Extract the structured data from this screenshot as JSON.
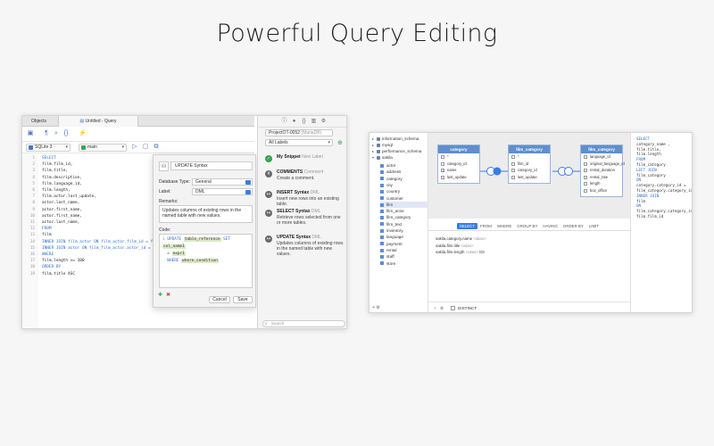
{
  "headline": "Powerful Query Editing",
  "left_window": {
    "tabs": [
      {
        "label": "Objects"
      },
      {
        "label": "Untitled - Query"
      }
    ],
    "connection": "SQLite 3",
    "schema": "main",
    "code_lines": [
      {
        "n": "1",
        "text": "SELECT"
      },
      {
        "n": "2",
        "text": "film.film_id,"
      },
      {
        "n": "3",
        "text": "film.title,"
      },
      {
        "n": "4",
        "text": "film.description,"
      },
      {
        "n": "5",
        "text": "film.language_id,"
      },
      {
        "n": "6",
        "text": "film.length,"
      },
      {
        "n": "7",
        "text": "film.actor.last_update,"
      },
      {
        "n": "8",
        "text": "actor.last_name,"
      },
      {
        "n": "9",
        "text": "actor.first_name,"
      },
      {
        "n": "10",
        "text": "actor.first_name,"
      },
      {
        "n": "11",
        "text": "actor.last_name,"
      },
      {
        "n": "12",
        "text": "FROM"
      },
      {
        "n": "13",
        "text": "film"
      },
      {
        "n": "14",
        "text": "INNER JOIN film_actor ON film_actor.film_id = film.film_id"
      },
      {
        "n": "15",
        "text": "INNER JOIN actor ON film_film_actor.actor_id = actor.actor_id"
      },
      {
        "n": "16",
        "text": "WHERE"
      },
      {
        "n": "17",
        "text": "film.length >= 100"
      },
      {
        "n": "18",
        "text": "ORDER BY"
      },
      {
        "n": "19",
        "text": "film.title ASC"
      }
    ],
    "snippet_editor": {
      "name": "UPDATE Syntax",
      "database_type_label": "Database Type:",
      "database_type": "General",
      "label_label": "Label:",
      "label_value": "DML",
      "remarks_label": "Remarks:",
      "remarks": "Updates columns of existing rows in the named table with new values.",
      "code_label": "Code:",
      "code_line1_n": "1",
      "code_update": "UPDATE",
      "code_table": "table_reference",
      "code_set": "SET",
      "code_col": "col_name1",
      "code_eq": "=",
      "code_expr": "expr1",
      "code_where": "WHERE",
      "code_cond": "where_condition",
      "cancel": "Cancel",
      "save": "Save"
    },
    "library": {
      "server": "ProjectOT-0052",
      "server_tag": "(MariaDB)",
      "filter": "All Labels",
      "items": [
        {
          "title": "My Snippet",
          "tag": "New Label",
          "desc": ""
        },
        {
          "title": "COMMENTS",
          "tag": "Comment",
          "desc": "Create a comment."
        },
        {
          "title": "INSERT Syntax",
          "tag": "DML",
          "desc": "Insert new rows into an existing table."
        },
        {
          "title": "SELECT Syntax",
          "tag": "DML",
          "desc": "Retrieve rows selected from one or more tables."
        },
        {
          "title": "UPDATE Syntax",
          "tag": "DML",
          "desc": "Updates columns of existing rows in the named table with new values."
        }
      ],
      "search_placeholder": "Search"
    }
  },
  "right_window": {
    "databases": [
      {
        "name": "information_schema"
      },
      {
        "name": "mysql"
      },
      {
        "name": "performance_schema"
      },
      {
        "name": "sakila"
      }
    ],
    "tables": [
      "actor",
      "address",
      "category",
      "city",
      "country",
      "customer",
      "film",
      "film_actor",
      "film_category",
      "film_text",
      "inventory",
      "language",
      "payment",
      "rental",
      "staff",
      "store"
    ],
    "selected_table": "film",
    "entities": [
      {
        "title": "category",
        "rows": [
          {
            "check": "",
            "name": "*"
          },
          {
            "check": "",
            "name": "category_id"
          },
          {
            "check": "✓",
            "name": "name"
          },
          {
            "check": "",
            "name": "last_update"
          }
        ]
      },
      {
        "title": "film_category",
        "rows": [
          {
            "check": "",
            "name": "*"
          },
          {
            "check": "",
            "name": "film_id"
          },
          {
            "check": "",
            "name": "category_id"
          },
          {
            "check": "",
            "name": "last_update"
          }
        ]
      },
      {
        "title": "film_category",
        "rows": [
          {
            "check": "",
            "name": "language_id"
          },
          {
            "check": "",
            "name": "original_language_id"
          },
          {
            "check": "",
            "name": "rental_duration"
          },
          {
            "check": "",
            "name": "rental_rate"
          },
          {
            "check": "",
            "name": "length"
          },
          {
            "check": "",
            "name": "box_office"
          }
        ]
      }
    ],
    "clauses": [
      "SELECT",
      "FROM",
      "WHERE",
      "GROUP BY",
      "HAVING",
      "ORDER BY",
      "LIMIT"
    ],
    "select_rows": [
      {
        "field": "sakila.category.name",
        "alias": "<alias>",
        "extra": ""
      },
      {
        "field": "sakila.film.title",
        "alias": "<alias>",
        "extra": ""
      },
      {
        "field": "sakila.film.length",
        "alias": "<alias>",
        "extra": "IDI"
      }
    ],
    "distinct_label": "DISTINCT",
    "sql_lines": [
      "SELECT",
      "  category_name ,",
      "  film.title,",
      "  film.length",
      "FROM",
      "  film_category",
      "  LEFT JOIN",
      "  film_category",
      "  ON",
      "    category.category_id =",
      "  film_category.category_id",
      "  INNER JOIN",
      "  film",
      "  ON",
      "    film_category.category_id =",
      "  film.film_id"
    ]
  }
}
